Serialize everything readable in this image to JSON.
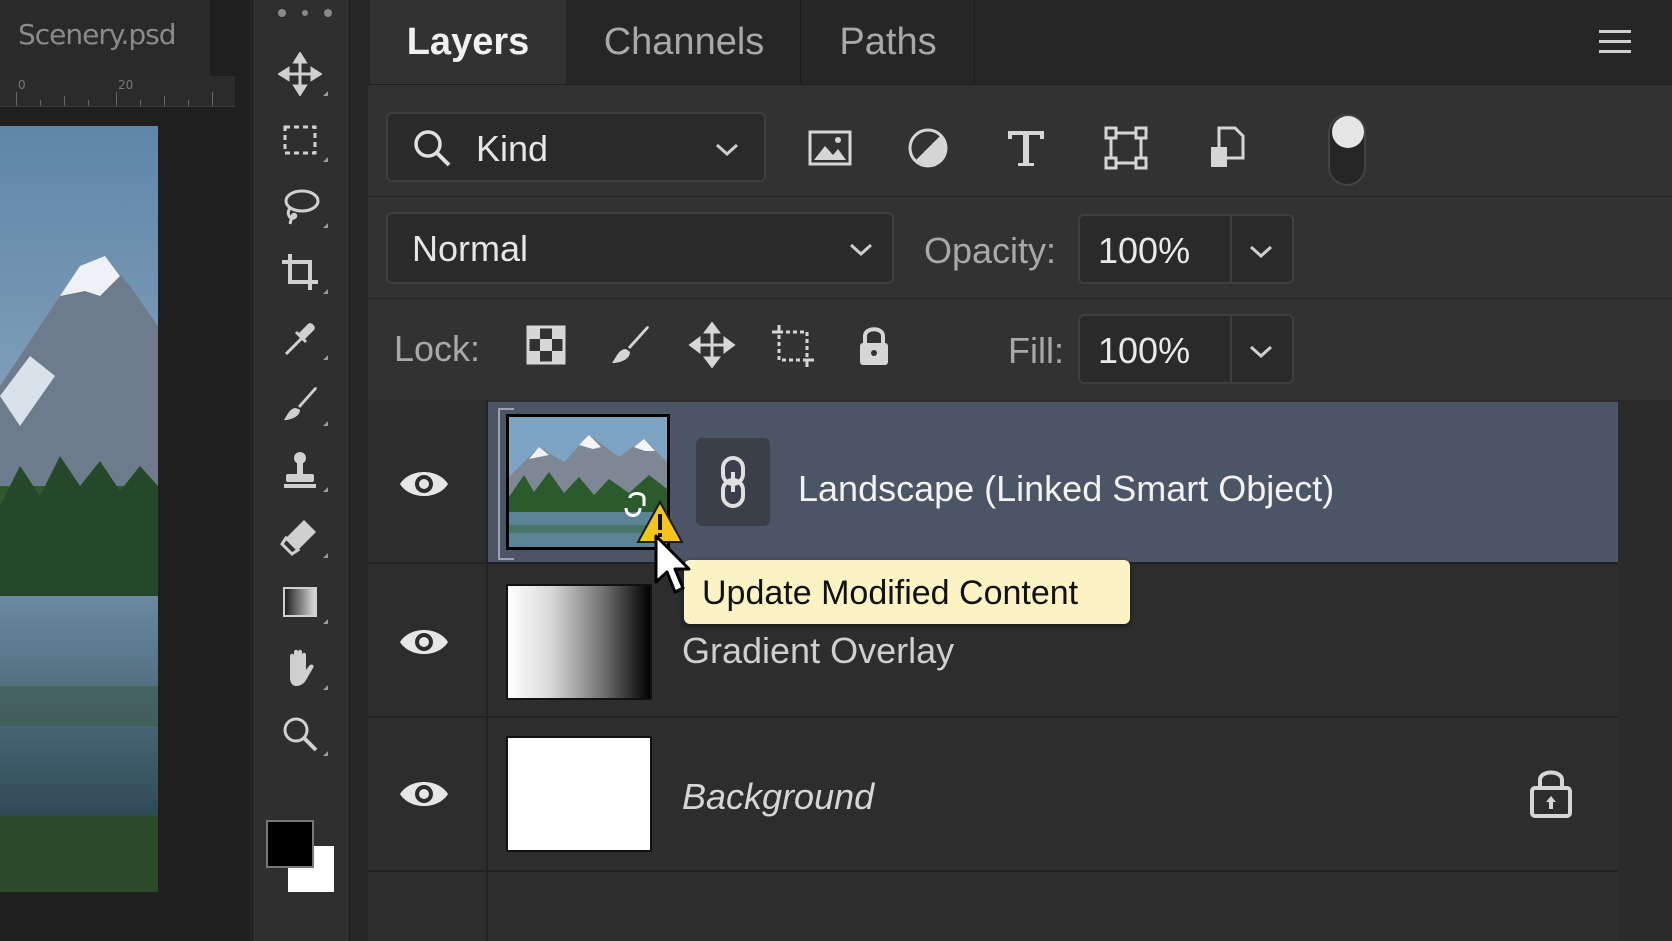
{
  "document": {
    "title": "Scenery.psd",
    "ruler_labels": [
      "0",
      "20"
    ]
  },
  "toolbar": {
    "tools": [
      "move-tool",
      "marquee-tool",
      "lasso-tool",
      "crop-tool",
      "eyedropper-tool",
      "brush-tool",
      "clone-stamp-tool",
      "eraser-tool",
      "gradient-tool",
      "hand-tool",
      "zoom-tool"
    ],
    "foreground_color": "#000000",
    "background_color": "#ffffff"
  },
  "panel": {
    "tabs": [
      {
        "label": "Layers",
        "active": true
      },
      {
        "label": "Channels",
        "active": false
      },
      {
        "label": "Paths",
        "active": false
      }
    ],
    "filter": {
      "kind_label": "Kind",
      "filter_icons": [
        "pixel-layer-filter-icon",
        "adjustment-layer-filter-icon",
        "type-layer-filter-icon",
        "shape-layer-filter-icon",
        "smart-object-filter-icon"
      ],
      "toggle_on": true
    },
    "blend": {
      "mode": "Normal",
      "opacity_label": "Opacity:",
      "opacity_value": "100%"
    },
    "lock": {
      "label": "Lock:",
      "icons": [
        "lock-transparent-pixels-icon",
        "lock-image-pixels-icon",
        "lock-position-icon",
        "lock-artboard-icon",
        "lock-all-icon"
      ],
      "fill_label": "Fill:",
      "fill_value": "100%"
    },
    "layers": [
      {
        "name": "Landscape (Linked Smart Object)",
        "visible": true,
        "selected": true,
        "linked": true,
        "warning": true
      },
      {
        "name": "Gradient Overlay",
        "visible": true,
        "selected": false
      },
      {
        "name": "Background",
        "visible": true,
        "selected": false,
        "locked": true
      }
    ],
    "tooltip": "Update Modified Content"
  },
  "colors": {
    "panel_bg": "#323232",
    "selected_row": "#4b5566",
    "tooltip_bg": "#fbf3c3",
    "warning": "#f5c518"
  }
}
